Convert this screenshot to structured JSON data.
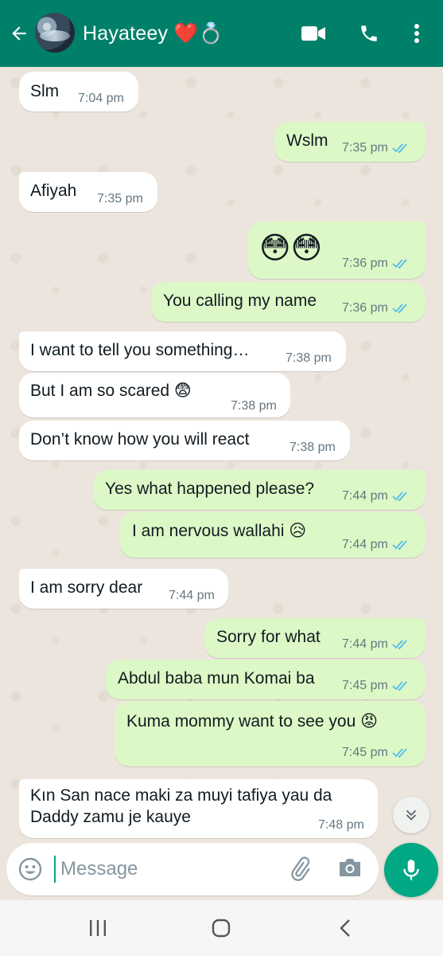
{
  "header": {
    "contact_name": "Hayateey ❤️💍",
    "icons": [
      "back-arrow-icon",
      "video-call-icon",
      "voice-call-icon",
      "more-options-icon"
    ]
  },
  "messages": [
    {
      "dir": "in",
      "text": "Slm",
      "time": "7:04 pm"
    },
    {
      "dir": "out",
      "text": "Wslm",
      "time": "7:35 pm",
      "status": "read"
    },
    {
      "dir": "in",
      "text": "Afiyah",
      "time": "7:35 pm"
    },
    {
      "dir": "out",
      "text": "😳😳",
      "time": "7:36 pm",
      "status": "read"
    },
    {
      "dir": "out",
      "text": "You calling my name",
      "time": "7:36 pm",
      "status": "read"
    },
    {
      "dir": "in",
      "text": "I want to tell you something…",
      "time": "7:38 pm"
    },
    {
      "dir": "in",
      "text": "But I am so scared 😨",
      "time": "7:38 pm"
    },
    {
      "dir": "in",
      "text": "Don’t know how you will react",
      "time": "7:38 pm"
    },
    {
      "dir": "out",
      "text": "Yes what happened please?",
      "time": "7:44 pm",
      "status": "read"
    },
    {
      "dir": "out",
      "text": "I am nervous wallahi 😥",
      "time": "7:44 pm",
      "status": "read"
    },
    {
      "dir": "in",
      "text": "I am sorry dear",
      "time": "7:44 pm"
    },
    {
      "dir": "out",
      "text": "Sorry for what",
      "time": "7:44 pm",
      "status": "read"
    },
    {
      "dir": "out",
      "text": "Abdul baba mun Komai ba",
      "time": "7:45 pm",
      "status": "read"
    },
    {
      "dir": "out",
      "text": "Kuma mommy want to see you 😡",
      "time": "7:45 pm",
      "status": "read"
    },
    {
      "dir": "in",
      "text_line1": "Kın San nace maki za muyi tafiya yau da",
      "text_line2": "Daddy zamu je kauye",
      "time": "7:48 pm"
    }
  ],
  "composer": {
    "placeholder": "Message",
    "icons": [
      "emoji-icon",
      "attach-icon",
      "camera-icon",
      "mic-icon"
    ]
  },
  "colors": {
    "header": "#008069",
    "outgoing_bubble": "#dcf8c6",
    "incoming_bubble": "#ffffff",
    "chat_background": "#ece5dd",
    "read_ticks": "#53bdeb",
    "accent": "#00a884"
  }
}
